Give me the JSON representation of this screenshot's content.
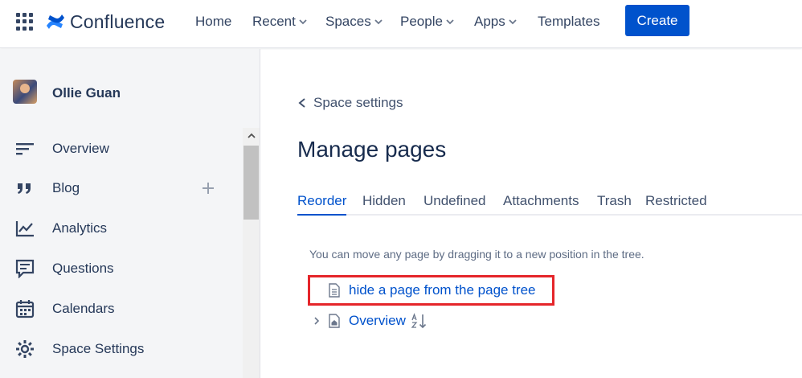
{
  "app": {
    "name": "Confluence"
  },
  "nav": {
    "items": [
      {
        "label": "Home"
      },
      {
        "label": "Recent"
      },
      {
        "label": "Spaces"
      },
      {
        "label": "People"
      },
      {
        "label": "Apps"
      },
      {
        "label": "Templates"
      }
    ],
    "create_label": "Create"
  },
  "sidebar": {
    "space_name": "Ollie Guan",
    "items": [
      {
        "label": "Overview",
        "icon": "overview-icon"
      },
      {
        "label": "Blog",
        "icon": "quote-icon"
      },
      {
        "label": "Analytics",
        "icon": "analytics-icon"
      },
      {
        "label": "Questions",
        "icon": "questions-icon"
      },
      {
        "label": "Calendars",
        "icon": "calendar-icon"
      },
      {
        "label": "Space Settings",
        "icon": "gear-icon"
      }
    ]
  },
  "main": {
    "breadcrumb": "Space settings",
    "title": "Manage pages",
    "tabs": [
      {
        "label": "Reorder"
      },
      {
        "label": "Hidden"
      },
      {
        "label": "Undefined"
      },
      {
        "label": "Attachments"
      },
      {
        "label": "Trash"
      },
      {
        "label": "Restricted"
      }
    ],
    "hint": "You can move any page by dragging it to a new position in the tree.",
    "tree": [
      {
        "label": "hide a page from the page tree"
      },
      {
        "label": "Overview"
      }
    ]
  },
  "colors": {
    "brand": "#0052cc",
    "highlight": "#e5252a",
    "sidebar_bg": "#f4f5f7"
  }
}
